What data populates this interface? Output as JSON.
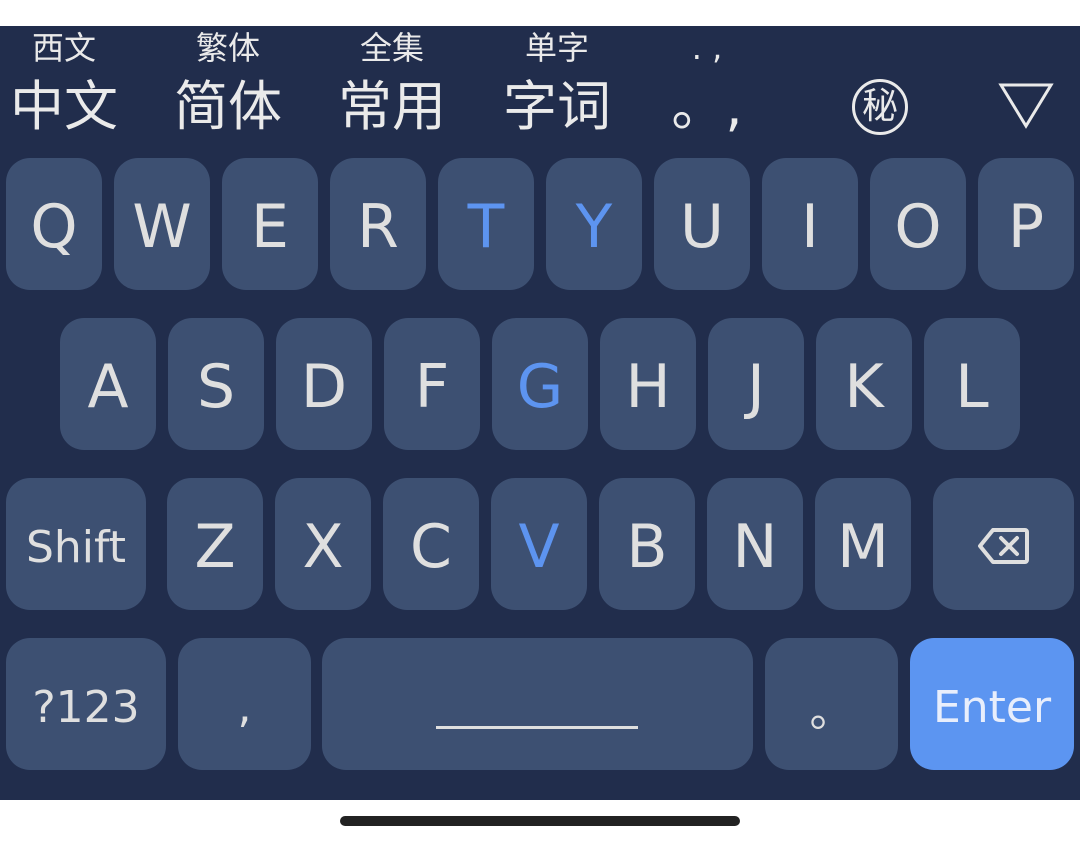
{
  "toolbar": {
    "items": [
      {
        "secondary": "西文",
        "primary": "中文"
      },
      {
        "secondary": "繁体",
        "primary": "简体"
      },
      {
        "secondary": "全集",
        "primary": "常用"
      },
      {
        "secondary": "单字",
        "primary": "字词"
      },
      {
        "secondary": ". ,",
        "primary": "。,"
      }
    ],
    "secret_label": "秘",
    "collapse_icon": "triangle-down-icon"
  },
  "keys": {
    "row1": [
      "Q",
      "W",
      "E",
      "R",
      "T",
      "Y",
      "U",
      "I",
      "O",
      "P"
    ],
    "row2": [
      "A",
      "S",
      "D",
      "F",
      "G",
      "H",
      "J",
      "K",
      "L"
    ],
    "row3": [
      "Z",
      "X",
      "C",
      "V",
      "B",
      "N",
      "M"
    ],
    "shift": "Shift",
    "backspace_icon": "backspace-icon",
    "numbers": "?123",
    "comma": ",",
    "space_icon": "space-bar-icon",
    "period": "。",
    "enter": "Enter"
  },
  "colors": {
    "keyboard_background": "#212d4c",
    "key_background": "#3d5072",
    "key_text": "#dfdfdf",
    "accent_text": "#5d94f0",
    "enter_background": "#5c95f1"
  }
}
